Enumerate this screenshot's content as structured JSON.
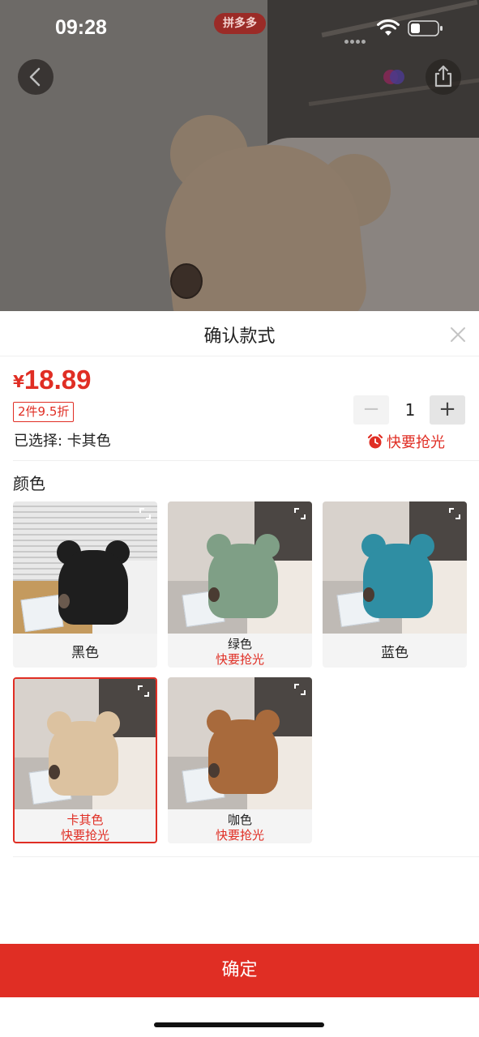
{
  "status_bar": {
    "time": "09:28",
    "center_badge": "拼多多",
    "icons": [
      "signal-icon",
      "wifi-icon",
      "battery-icon"
    ]
  },
  "overlay": {
    "icons": [
      "back-icon",
      "favorite-icon",
      "share-icon"
    ]
  },
  "sheet": {
    "title": "确认款式",
    "close_icon": "close-icon"
  },
  "product": {
    "price_symbol": "¥",
    "price_value": "18.89",
    "discount_badge": "2件9.5折",
    "selected_label": "已选择: 卡其色",
    "hurry_text": "快要抢光",
    "hurry_icon": "alarm-clock-icon"
  },
  "quantity": {
    "minus": "−",
    "value": "1",
    "plus": "+"
  },
  "color_section": {
    "label": "颜色",
    "options": [
      {
        "name": "黑色",
        "note": ""
      },
      {
        "name": "绿色",
        "note": "快要抢光"
      },
      {
        "name": "蓝色",
        "note": ""
      },
      {
        "name": "卡其色",
        "note": "快要抢光",
        "selected": true
      },
      {
        "name": "咖色",
        "note": "快要抢光"
      }
    ]
  },
  "colors": {
    "accent": "#e02e24",
    "black_bag": "#1e1e1e",
    "green_bag": "#7f9f86",
    "blue_bag": "#2f8ea3",
    "khaki_bag": "#dcc2a0",
    "brown_bag": "#a86a3c"
  },
  "confirm": {
    "label": "确定"
  }
}
